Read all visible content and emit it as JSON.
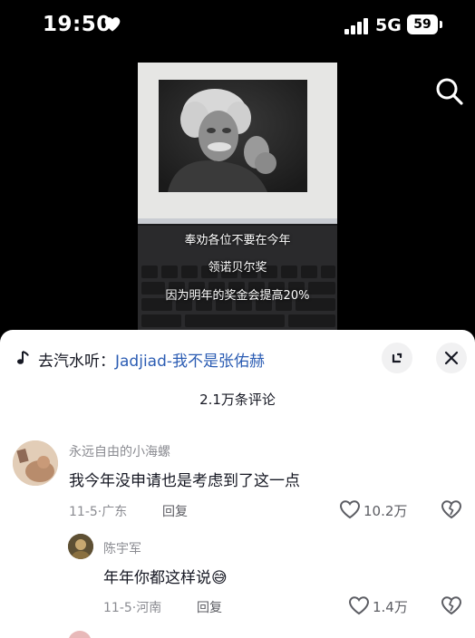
{
  "status_bar": {
    "time": "19:50",
    "network": "5G",
    "battery_level": "59"
  },
  "video": {
    "captions": [
      "奉劝各位不要在今年",
      "领诺贝尔奖",
      "因为明年的奖金会提高20%"
    ]
  },
  "comments_panel": {
    "music_prefix": "去汽水听：",
    "music_title": "Jadjiad-我不是张佑赫",
    "count_text": "2.1万条评论",
    "comments": [
      {
        "author": "永远自由的小海螺",
        "text": "我今年没申请也是考虑到了这一点",
        "date": "11-5",
        "location": "广东",
        "reply_label": "回复",
        "likes": "10.2万"
      }
    ],
    "replies": [
      {
        "author": "陈宇军",
        "text": "年年你都这样说",
        "emoji": "😅",
        "date": "11-5",
        "location": "河南",
        "reply_label": "回复",
        "likes": "1.4万"
      }
    ]
  }
}
